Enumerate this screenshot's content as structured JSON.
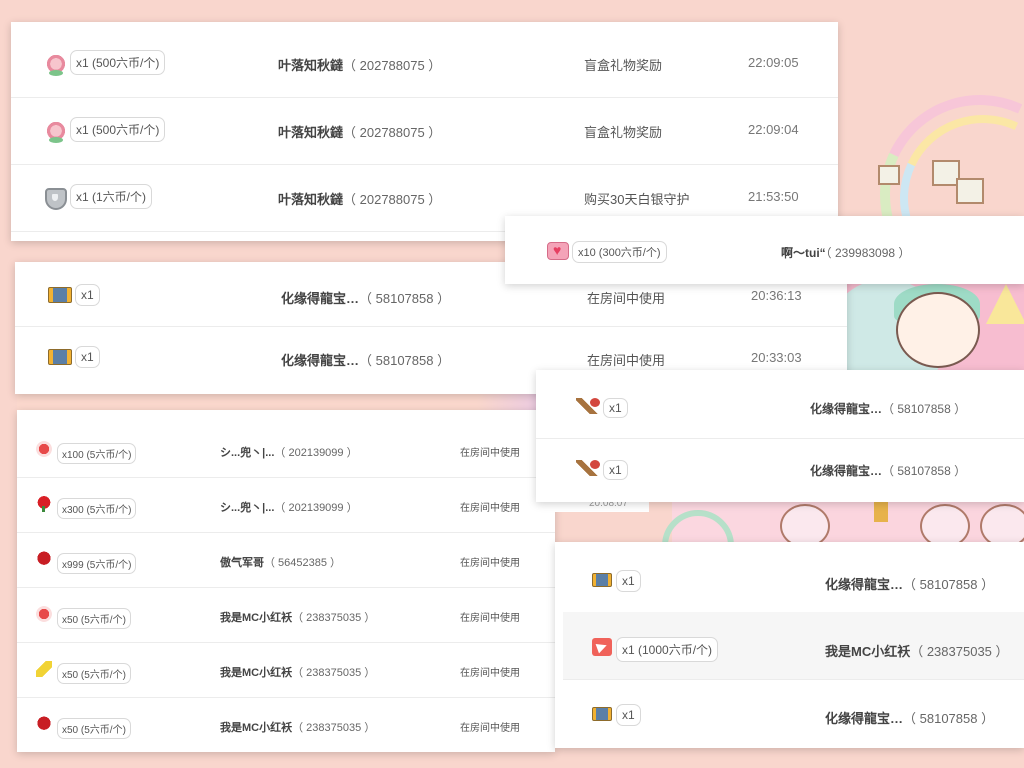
{
  "card1": {
    "rows": [
      {
        "icon": "flower-gift-icon",
        "qty": "x1 (500六币/个)",
        "user": "叶落知秋鐽",
        "uid": "（ 202788075 ）",
        "source": "盲盒礼物奖励",
        "time": "22:09:05"
      },
      {
        "icon": "flower-gift-icon",
        "qty": "x1 (500六币/个)",
        "user": "叶落知秋鐽",
        "uid": "（ 202788075 ）",
        "source": "盲盒礼物奖励",
        "time": "22:09:04"
      },
      {
        "icon": "silver-shield-icon",
        "qty": "x1 (1六币/个)",
        "user": "叶落知秋鐽",
        "uid": "（ 202788075 ）",
        "source": "购买30天白银守护",
        "time": "21:53:50"
      }
    ]
  },
  "card2": {
    "rows": [
      {
        "icon": "ticket-icon",
        "qty": "x1",
        "user": "化缘得龍宝…",
        "uid": "（ 58107858 ）",
        "source": "在房间中使用",
        "time": "20:36:13"
      },
      {
        "icon": "ticket-icon",
        "qty": "x1",
        "user": "化缘得龍宝…",
        "uid": "（ 58107858 ）",
        "source": "在房间中使用",
        "time": "20:33:03"
      }
    ]
  },
  "card3": {
    "rows": [
      {
        "icon": "heart-box-icon",
        "qty": "x10 (300六币/个)",
        "user": "啊～tui“",
        "uid": "（ 239983098 ）"
      }
    ]
  },
  "card4": {
    "rows": [
      {
        "icon": "lollipop-icon",
        "qty": "x100 (5六币/个)",
        "user": "シ...兜丶|...",
        "uid": "（ 202139099 ）",
        "source": "在房间中使用"
      },
      {
        "icon": "rose-icon",
        "qty": "x300 (5六币/个)",
        "user": "シ...兜丶|...",
        "uid": "（ 202139099 ）",
        "source": "在房间中使用"
      },
      {
        "icon": "red-rose-icon",
        "qty": "x999 (5六币/个)",
        "user": "傲气军哥",
        "uid": "（ 56452385 ）",
        "source": "在房间中使用"
      },
      {
        "icon": "lollipop-icon",
        "qty": "x50 (5六币/个)",
        "user": "我是MC小红袄",
        "uid": "（ 238375035 ）",
        "source": "在房间中使用"
      },
      {
        "icon": "pencil-icon",
        "qty": "x50 (5六币/个)",
        "user": "我是MC小红袄",
        "uid": "（ 238375035 ）",
        "source": "在房间中使用"
      },
      {
        "icon": "red-rose-icon",
        "qty": "x50 (5六币/个)",
        "user": "我是MC小红袄",
        "uid": "（ 238375035 ）",
        "source": "在房间中使用"
      }
    ],
    "time_peek": "20:08:07"
  },
  "card5": {
    "rows": [
      {
        "icon": "cannon-icon",
        "qty": "x1",
        "user": "化缘得龍宝…",
        "uid": "（ 58107858 ）"
      },
      {
        "icon": "cannon-icon",
        "qty": "x1",
        "user": "化缘得龍宝…",
        "uid": "（ 58107858 ）"
      }
    ]
  },
  "card6": {
    "rows": [
      {
        "icon": "ticket-icon",
        "qty": "x1",
        "user": "化缘得龍宝…",
        "uid": "（ 58107858 ）"
      },
      {
        "icon": "paper-plane-icon",
        "qty": "x1 (1000六币/个)",
        "user": "我是MC小红袄",
        "uid": "（ 238375035 ）"
      },
      {
        "icon": "ticket-icon",
        "qty": "x1",
        "user": "化缘得龍宝…",
        "uid": "（ 58107858 ）"
      }
    ]
  }
}
